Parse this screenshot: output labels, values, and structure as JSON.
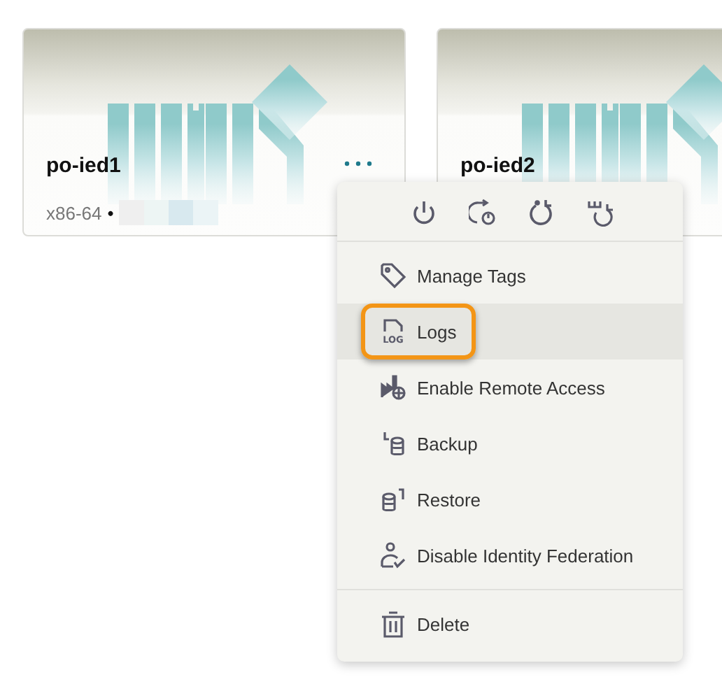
{
  "devices": [
    {
      "name": "po-ied1",
      "arch": "x86-64",
      "separator": "•"
    },
    {
      "name": "po-ied2"
    }
  ],
  "menu": {
    "open": true,
    "groups": [
      [
        {
          "label": "Manage Tags",
          "kind": "tags",
          "selected": false
        },
        {
          "label": "Logs",
          "kind": "logs",
          "icon_text": "LOG",
          "selected": true
        },
        {
          "label": "Enable Remote Access",
          "kind": "remote",
          "selected": false
        },
        {
          "label": "Backup",
          "kind": "backup",
          "selected": false
        },
        {
          "label": "Restore",
          "kind": "restore",
          "selected": false
        },
        {
          "label": "Disable Identity Federation",
          "kind": "identity",
          "selected": false
        }
      ],
      [
        {
          "label": "Delete",
          "kind": "delete",
          "selected": false
        }
      ]
    ]
  }
}
